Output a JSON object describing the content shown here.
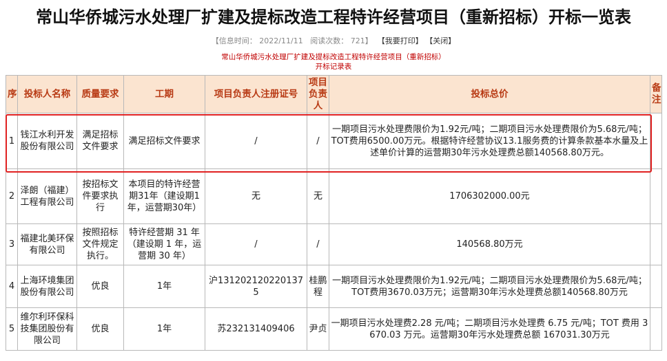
{
  "title": "常山华侨城污水处理厂扩建及提标改造工程特许经营项目（重新招标）开标一览表",
  "meta": {
    "info_time_label": "【信息时间：",
    "info_time": "2022/11/11",
    "views_label": "阅读次数：",
    "views": "721",
    "close_bracket": "】",
    "print_label": "【我要打印】",
    "close_label": "【关闭】"
  },
  "subtitle": {
    "line1": "常山华侨城污水处理厂扩建及提标改造工程特许经营项目（重新招标）",
    "line2": "开标记录表"
  },
  "table": {
    "headers": [
      "序",
      "投标人名称",
      "质量要求",
      "工期",
      "项目负责人注册证号",
      "项目负责人",
      "投标总价",
      "备注"
    ],
    "rows": [
      {
        "no": "1",
        "name": "钱江水利开发股份有限公司",
        "quality": "满足招标文件要求",
        "period": "满足招标文件要求",
        "cert": "/",
        "manager": "/",
        "price": "一期项目污水处理费限价为1.92元/吨；二期项目污水处理费限价为5.68元/吨；TOT费用6500.00万元。根据特许经营协议13.1服务费的计算条款基本水量及上述单价计算的运营期30年污水处理费总额140568.80万元。",
        "note": ""
      },
      {
        "no": "2",
        "name": "泽朗（福建）工程有限公司",
        "quality": "按招标文件要求执行",
        "period": "本项目的特许经营期31年（建设期1年，运营期30年）",
        "cert": "无",
        "manager": "无",
        "price": "1706302000.00元",
        "note": ""
      },
      {
        "no": "3",
        "name": "福建北美环保有限公司",
        "quality": "按照招标文件规定执行。",
        "period": "特许经营期 31 年（建设期 1 年，运营期 30 年）",
        "cert": "/",
        "manager": "/",
        "price": "140568.80万元",
        "note": ""
      },
      {
        "no": "4",
        "name": "上海环境集团股份有限公司",
        "quality": "优良",
        "period": "1年",
        "cert": "沪1312021202201375",
        "manager": "桂鹏程",
        "price": "一期项目污水处理费限价为1.92元/吨；二期项目污水处理费限价为5.68元/吨；TOT费用3670.03万元；运营期30年污水处理费总额140568.80万元",
        "note": ""
      },
      {
        "no": "5",
        "name": "维尔利环保科技集团股份有限公司",
        "quality": "优良",
        "period": "1年",
        "cert": "苏232131409406",
        "manager": "尹贞",
        "price": "一期项目污水处理费2.28 元/吨；二期项目污水处理费 6.75 元/吨；TOT 费用 3670.03 万元。运营期30年污水处理费总额 167031.30万元",
        "note": ""
      }
    ]
  }
}
